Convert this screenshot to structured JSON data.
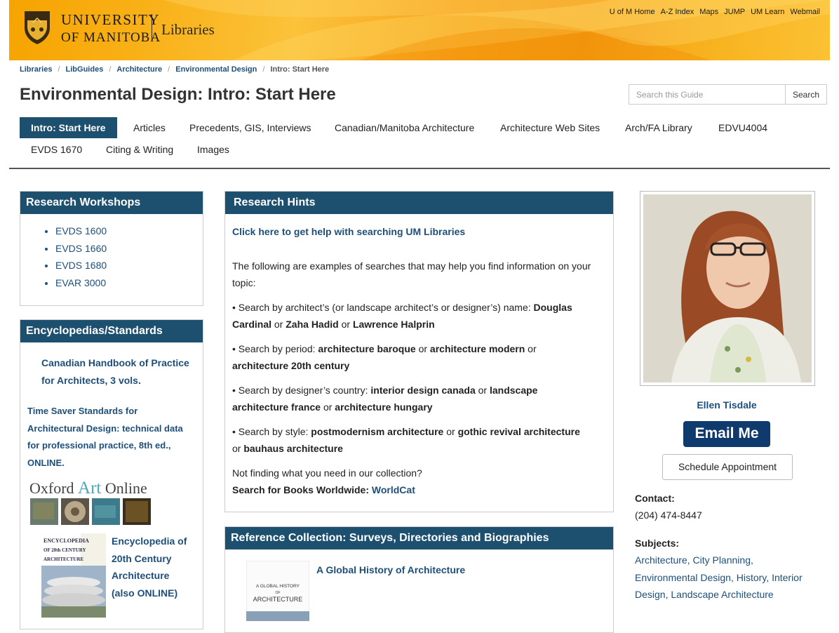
{
  "header": {
    "university_line1": "UNIVERSITY",
    "university_line2": "OF MANITOBA",
    "site_name": "Libraries",
    "top_links": [
      "U of M Home",
      "A-Z Index",
      "Maps",
      "JUMP",
      "UM Learn",
      "Webmail"
    ]
  },
  "breadcrumb": [
    "Libraries",
    "LibGuides",
    "Architecture",
    "Environmental Design",
    "Intro: Start Here"
  ],
  "page_title": "Environmental Design: Intro: Start Here",
  "search": {
    "placeholder": "Search this Guide",
    "button": "Search"
  },
  "tabs": [
    "Intro: Start Here",
    "Articles",
    "Precedents, GIS, Interviews",
    "Canadian/Manitoba Architecture",
    "Architecture Web Sites",
    "Arch/FA Library",
    "EDVU4004",
    "EVDS 1670",
    "Citing & Writing",
    "Images"
  ],
  "workshops": {
    "title": "Research Workshops",
    "items": [
      "EVDS 1600",
      "EVDS 1660",
      "EVDS 1680",
      "EVAR 3000"
    ]
  },
  "encyclopedias": {
    "title": "Encyclopedias/Standards",
    "item1": [
      "Canadian Handbook of Practice",
      "for Architects, 3 vols."
    ],
    "item2": [
      "Time Saver Standards for",
      "Architectural Design: technical data",
      "for professional practice, 8th ed.,",
      "ONLINE."
    ],
    "oxford_logo_a": "Oxford ",
    "oxford_logo_b": "Art",
    "oxford_logo_c": " Online",
    "item3": [
      "Encyclopedia of",
      "20th Century",
      "Architecture",
      "(also ONLINE)"
    ],
    "book_cover_text": [
      "ENCYCLOPEDIA",
      "OF 20th CENTURY",
      "ARCHITECTURE"
    ]
  },
  "hints": {
    "title": "Research Hints",
    "help_link": "Click here to get help with searching UM Libraries",
    "intro_a": "The following are examples of searches that may help you find information on your",
    "intro_b": "topic:",
    "s1_a": " • Search by architect’s (or landscape architect’s or designer’s) name: ",
    "s1_b": "Douglas",
    "s1_c": "Cardinal",
    "s1_d": " or ",
    "s1_e": "Zaha Hadid",
    "s1_f": " or ",
    "s1_g": "Lawrence Halprin",
    "s2_a": "• Search by period: ",
    "s2_b": "architecture baroque",
    "s2_c": " or ",
    "s2_d": "architecture modern",
    "s2_e": " or",
    "s2_f": "architecture 20th century",
    "s3_a": " • Search by designer’s country: ",
    "s3_b": "interior design canada",
    "s3_c": " or ",
    "s3_d": "landscape",
    "s3_e": "architecture france",
    "s3_f": " or ",
    "s3_g": "architecture hungary",
    "s4_a": "• Search by style: ",
    "s4_b": "postmodernism architecture",
    "s4_c": " or ",
    "s4_d": "gothic revival architecture",
    "s4_e": "or ",
    "s4_f": "bauhaus architecture",
    "not_finding": "Not finding what you need in our collection?",
    "worldwide_label": "Search for Books Worldwide: ",
    "worldcat": "WorldCat"
  },
  "reference": {
    "title": "Reference Collection: Surveys, Directories and Biographies",
    "book_title": "A Global History of Architecture",
    "cover_text": [
      "A GLOBAL HISTORY",
      "OF",
      "ARCHITECTURE"
    ]
  },
  "profile": {
    "name": "Ellen Tisdale",
    "email_button": "Email Me",
    "schedule_button": "Schedule Appointment",
    "contact_label": "Contact:",
    "phone": "(204) 474-8447",
    "subjects_label": "Subjects:",
    "subjects": [
      "Architecture",
      "City Planning",
      "Environmental Design",
      "History",
      "Interior Design",
      "Landscape Architecture"
    ]
  },
  "colors": {
    "header_bg": "#f7a81b",
    "box_header": "#1d4f6f",
    "link": "#1d4f7a",
    "email_button": "#0f3a6e"
  }
}
